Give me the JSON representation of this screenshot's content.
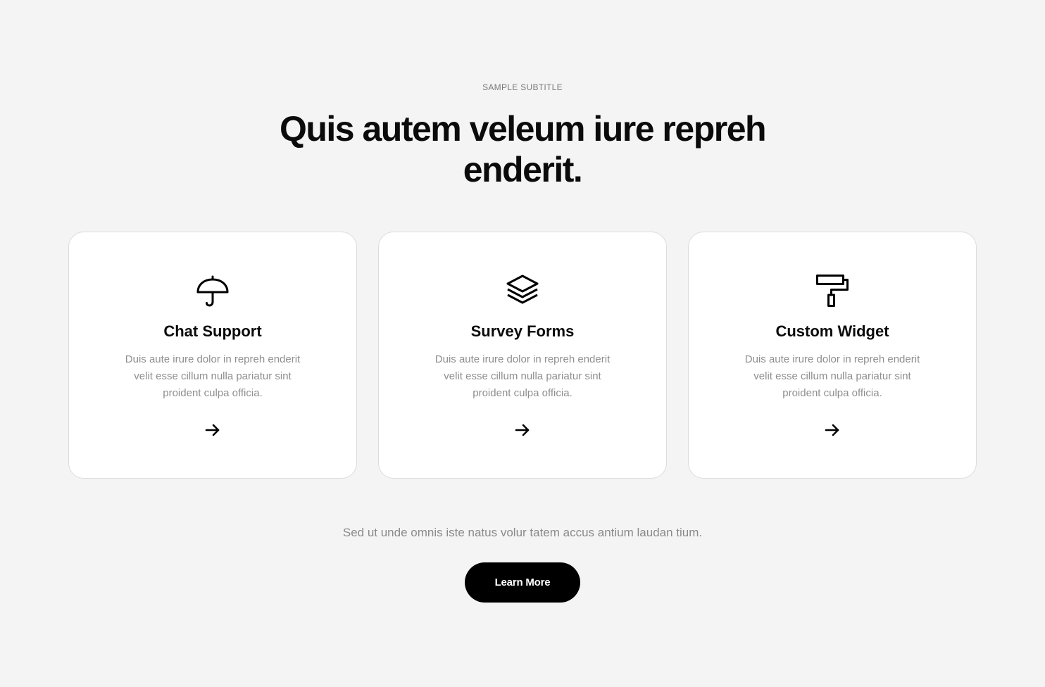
{
  "header": {
    "subtitle": "SAMPLE SUBTITLE",
    "title": "Quis autem veleum iure repreh enderit."
  },
  "cards": [
    {
      "icon": "umbrella-icon",
      "title": "Chat Support",
      "text": "Duis aute irure dolor in repreh enderit velit esse cillum nulla pariatur sint proident culpa officia.",
      "arrow_icon": "arrow-right-icon"
    },
    {
      "icon": "layers-icon",
      "title": "Survey Forms",
      "text": "Duis aute irure dolor in repreh enderit velit esse cillum nulla pariatur sint proident culpa officia.",
      "arrow_icon": "arrow-right-icon"
    },
    {
      "icon": "paint-roller-icon",
      "title": "Custom Widget",
      "text": "Duis aute irure dolor in repreh enderit velit esse cillum nulla pariatur sint proident culpa officia.",
      "arrow_icon": "arrow-right-icon"
    }
  ],
  "footer": {
    "text": "Sed ut unde omnis iste natus volur tatem accus antium laudan tium.",
    "button_label": "Learn More"
  },
  "colors": {
    "background": "#f4f4f4",
    "card_background": "#ffffff",
    "text_primary": "#0b0b0b",
    "text_muted": "#8e8e8e",
    "button_background": "#000000",
    "button_text": "#ffffff"
  }
}
